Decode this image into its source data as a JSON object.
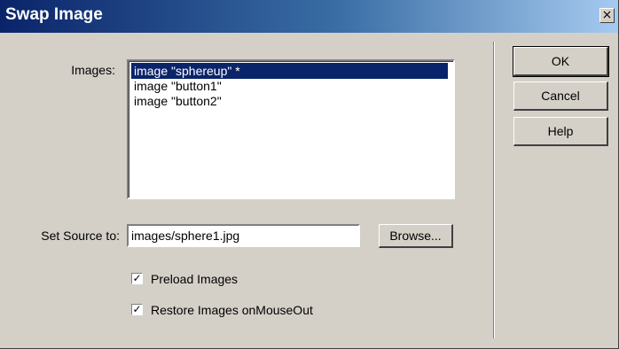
{
  "window": {
    "title": "Swap Image",
    "close_glyph": "×"
  },
  "images": {
    "label": "Images:",
    "items": [
      {
        "label": "image \"sphereup\" *",
        "selected": true
      },
      {
        "label": "image \"button1\"",
        "selected": false
      },
      {
        "label": "image \"button2\"",
        "selected": false
      }
    ]
  },
  "source": {
    "label": "Set Source to:",
    "value": "images/sphere1.jpg",
    "browse_label": "Browse..."
  },
  "options": {
    "preload": {
      "label": "Preload Images",
      "checked": true
    },
    "restore": {
      "label": "Restore Images onMouseOut",
      "checked": true
    }
  },
  "buttons": {
    "ok": "OK",
    "cancel": "Cancel",
    "help": "Help"
  },
  "colors": {
    "selection": "#0a246a",
    "face": "#d4d0c8",
    "title_start": "#0a246a",
    "title_end": "#a6caf0"
  }
}
